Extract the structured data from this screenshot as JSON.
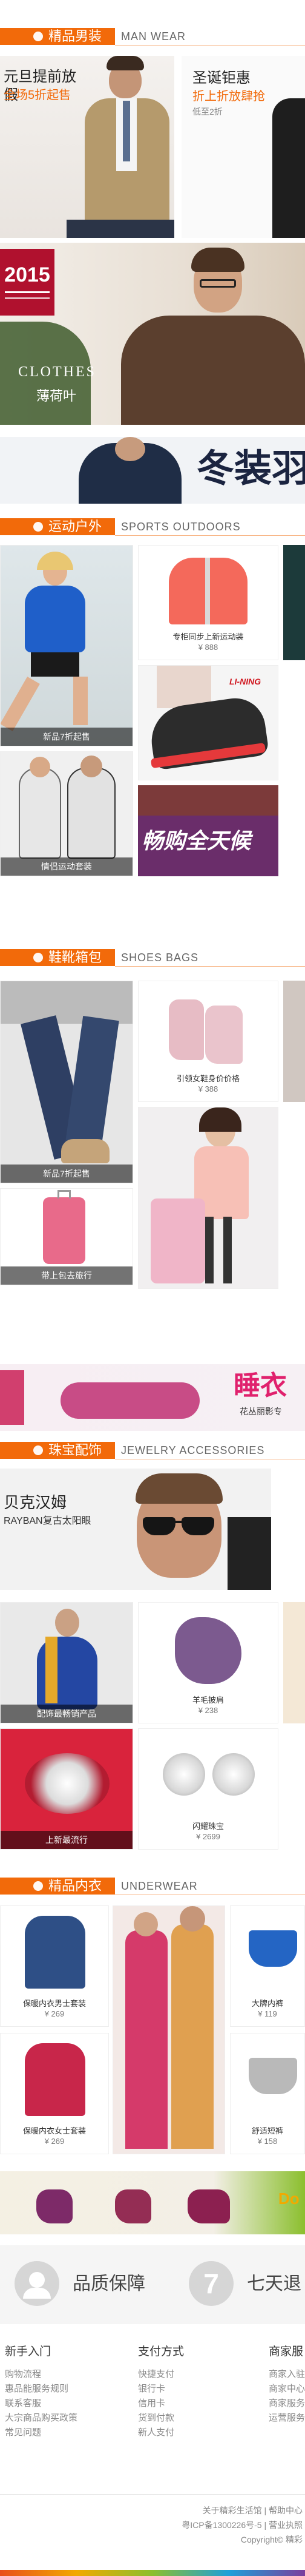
{
  "sections": {
    "men": {
      "title": "精品男装",
      "en": "MAN  WEAR"
    },
    "sports": {
      "title": "运动户外",
      "en": "SPORTS  OUTDOORS"
    },
    "shoes": {
      "title": "鞋靴箱包",
      "en": "SHOES  BAGS"
    },
    "jewelry": {
      "title": "珠宝配饰",
      "en": "JEWELRY  ACCESSORIES"
    },
    "underwear": {
      "title": "精品内衣",
      "en": "UNDERWEAR"
    }
  },
  "men": {
    "banner1": {
      "line1": "元旦提前放假",
      "line2": "全场5折起售"
    },
    "banner2": {
      "line1": "圣诞钜惠",
      "line2": "折上折放肆抢",
      "line3": "低至2折"
    },
    "promo": {
      "year": "2015",
      "brand": "CLOTHES",
      "sub": "薄荷叶"
    },
    "winter": {
      "text": "冬装羽"
    }
  },
  "sports": {
    "cap1": "新品7折起售",
    "cap2": "情侣运动套装",
    "p1": {
      "name": "专柜同步上新运动装",
      "price": "¥ 888"
    },
    "brand": "LI-NING",
    "slogan": "畅购全天候"
  },
  "shoes": {
    "cap1": "新品7折起售",
    "cap2": "带上包去旅行",
    "p1": {
      "name": "引领女鞋身价价格",
      "price": "¥ 388"
    },
    "banner": {
      "text": "睡衣",
      "sub": "花丛丽影专"
    }
  },
  "jewelry": {
    "banner": {
      "line1": "贝克汉姆",
      "line2": "RAYBAN复古太阳眼"
    },
    "cap1": "配饰最畅销产品",
    "cap2": "上新最流行",
    "p1": {
      "name": "羊毛披肩",
      "price": "¥ 238"
    },
    "p2": {
      "name": "闪耀珠宝",
      "price": "¥ 2699"
    }
  },
  "underwear": {
    "p1": {
      "name": "保暖内衣男士套装",
      "price": "¥ 269"
    },
    "p2": {
      "name": "保暖内衣女士套装",
      "price": "¥ 269"
    },
    "p3": {
      "name": "大牌内裤",
      "price": "¥ 119"
    },
    "p4": {
      "name": "舒适短裤",
      "price": "¥ 158"
    },
    "banner_text": "Do"
  },
  "guarantee": {
    "item1": "品质保障",
    "item2_num": "7",
    "item2": "七天退"
  },
  "footer": {
    "cols": [
      {
        "title": "新手入门",
        "items": [
          "购物流程",
          "惠品能服务规则",
          "联系客服",
          "大宗商品购买政策",
          "常见问题"
        ]
      },
      {
        "title": "支付方式",
        "items": [
          "快捷支付",
          "银行卡",
          "信用卡",
          "货到付款",
          "新人支付"
        ]
      },
      {
        "title": "商家服",
        "items": [
          "商家入驻",
          "商家中心",
          "商家服务",
          "运营服务"
        ]
      }
    ],
    "links": "关于精彩生活馆 | 帮助中心",
    "icp": "粤ICP备1300226号-5 | 营业执照",
    "copyright": "Copyright© 精彩"
  },
  "colors": {
    "accent": "#f26a0a",
    "footer_bar": "#f2a900"
  }
}
